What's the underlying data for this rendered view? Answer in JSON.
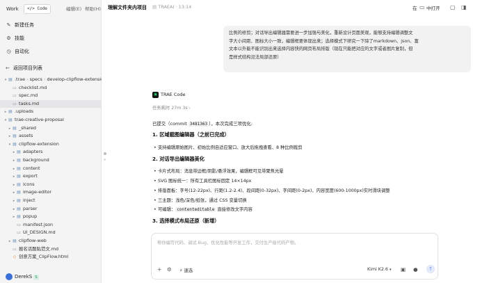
{
  "topbar": {
    "tabs": [
      "Work",
      "Code"
    ],
    "menu": [
      "编辑(E)",
      "帮助(H)"
    ]
  },
  "actions": [
    {
      "label": "新建任务",
      "icon": "pencil-icon"
    },
    {
      "label": "技能",
      "icon": "skill-icon"
    },
    {
      "label": "自动化",
      "icon": "clock-icon"
    }
  ],
  "back_label": "返回项目列表",
  "tree": [
    {
      "label": ".trae",
      "sep1": "specs",
      "sep2": "develop-clipflow-extension",
      "kind": "path"
    },
    {
      "label": "checklist.md",
      "kind": "file",
      "depth": 2
    },
    {
      "label": "spec.md",
      "kind": "file",
      "depth": 2
    },
    {
      "label": "tasks.md",
      "kind": "file",
      "depth": 2,
      "selected": true
    },
    {
      "label": ".uploads",
      "kind": "folder",
      "depth": 0,
      "open": false
    },
    {
      "label": "trae-creative-proposal",
      "kind": "folder",
      "depth": 0,
      "open": true
    },
    {
      "label": "_shared",
      "kind": "folder",
      "depth": 1,
      "open": false
    },
    {
      "label": "assets",
      "kind": "folder",
      "depth": 1,
      "open": false
    },
    {
      "label": "clipflow-extension",
      "kind": "folder",
      "depth": 1,
      "open": true
    },
    {
      "label": "adapters",
      "kind": "folder",
      "depth": 2,
      "open": false
    },
    {
      "label": "background",
      "kind": "folder",
      "depth": 2,
      "open": false
    },
    {
      "label": "content",
      "kind": "folder",
      "depth": 2,
      "open": false
    },
    {
      "label": "export",
      "kind": "folder",
      "depth": 2,
      "open": false
    },
    {
      "label": "icons",
      "kind": "folder",
      "depth": 2,
      "open": false
    },
    {
      "label": "image-editor",
      "kind": "folder",
      "depth": 2,
      "open": false
    },
    {
      "label": "inject",
      "kind": "folder",
      "depth": 2,
      "open": false
    },
    {
      "label": "parser",
      "kind": "folder",
      "depth": 2,
      "open": false
    },
    {
      "label": "popup",
      "kind": "folder",
      "depth": 2,
      "open": false
    },
    {
      "label": "manifest.json",
      "kind": "file",
      "depth": 2
    },
    {
      "label": "UI_DESIGN.md",
      "kind": "file",
      "depth": 2
    },
    {
      "label": "clipflow-web",
      "kind": "folder",
      "depth": 1,
      "open": false
    },
    {
      "label": "报名话题贴范文.md",
      "kind": "file",
      "depth": 1
    },
    {
      "label": "创意方案_ClipFlow.html",
      "kind": "file",
      "depth": 1
    }
  ],
  "user": {
    "name": "DerekS",
    "badge": "S"
  },
  "header": {
    "title": "理解文件夹内项目",
    "meta": "TRAEAI · 13:14",
    "in_label": "在",
    "open_label": "中打开"
  },
  "bubble_lines": [
    "比例的修剪；对话导出编辑器需要进一步加强与美化，重新设计页面美观，能够支持编辑调整文",
    "字大小间距、图标大小一致，编辑框要体现出来；选择模式下研究一下除了markdown、json、富",
    "文本以外能不能识别出来选择内容快的网页布局排版（现在只能把对应的文字或者图片复制，但",
    "是样式结构没法局部还原）"
  ],
  "reply": {
    "bot_name": "TRAE Code",
    "elapsed": "任务耗时 27m 3s",
    "commit_prefix": "已提交（commit",
    "commit_hash": "3481363",
    "commit_suffix": "），本次完成三项优化:",
    "h1": "1. 区域截图编辑器（之前已完成）",
    "h1_items": [
      "支持编辑原始图片、初始比例自适应窗口、放大后拖拽查看、8 种比例裁剪"
    ],
    "h2": "2. 对话导出编辑器美化",
    "h2_items": [
      "卡片式布局：消息带边框/阴影/悬浮效果，编辑框可见带聚焦光晕",
      "SVG 图标统一：所有工具栏图标固定 14×14px",
      "排版面板：字号(12-22px)、行距(1.2-2.4)、段间距(0-32px)、字间距(0-2px)、内容宽度(600-1000px)实时滑块调整",
      "三主题：浅色/深色/纸张，通过 CSS 变量切换"
    ],
    "h2_last_prefix": "可编辑：",
    "h2_last_code": "contenteditable",
    "h2_last_suffix": " 直接修改文字内容",
    "h3": "3. 选择模式布局还原（新增）"
  },
  "composer": {
    "placeholder": "帮你编写代码、调试 Bug、优化性能等开发工作，交付生产级代码产物。",
    "speed_label": "速选",
    "model_label": "Kimi K2.6"
  }
}
